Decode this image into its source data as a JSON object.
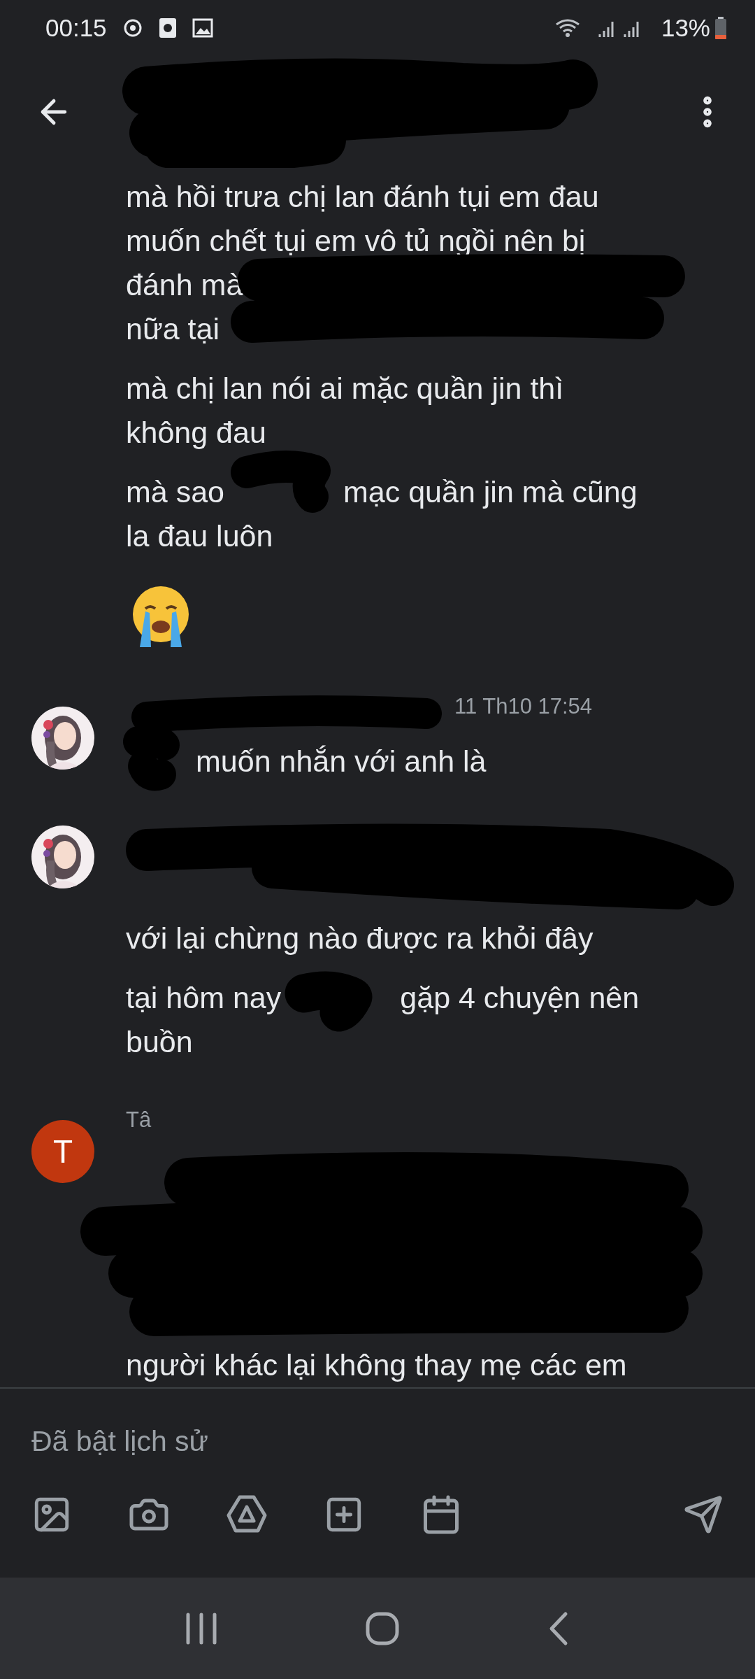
{
  "status_bar": {
    "time": "00:15",
    "battery": "13%"
  },
  "compose": {
    "placeholder": "Đã bật lịch sử"
  },
  "groups": [
    {
      "messages": [
        {
          "kind": "text",
          "lines": [
            [
              {
                "kind": "text",
                "text": "mà hồi trưa chị lan đánh tụi em đau"
              }
            ],
            [
              {
                "kind": "text",
                "text": "muốn chết tụi em vô tủ ngồi nên bị"
              }
            ],
            [
              {
                "kind": "text",
                "text": "đánh mà"
              }
            ],
            [
              {
                "kind": "text",
                "text": "nữa tại"
              }
            ]
          ]
        },
        {
          "kind": "text",
          "lines": [
            [
              {
                "kind": "text",
                "text": "mà chị lan nói ai mặc quần jin thì"
              }
            ],
            [
              {
                "kind": "text",
                "text": "không đau"
              }
            ]
          ]
        },
        {
          "kind": "text",
          "lines": [
            [
              {
                "kind": "text",
                "text": "mà sao"
              },
              {
                "kind": "hidden"
              },
              {
                "kind": "text",
                "text": "mạc quần jin mà cũng"
              }
            ],
            [
              {
                "kind": "text",
                "text": "la đau luôn"
              }
            ]
          ]
        },
        {
          "kind": "sticker"
        }
      ]
    },
    {
      "avatar": {
        "kind": "picture"
      },
      "time": "11 Th10 17:54",
      "messages": [
        {
          "kind": "text",
          "lines": [
            [
              {
                "kind": "hidden"
              },
              {
                "kind": "text",
                "text": "muốn nhắn với anh là"
              }
            ]
          ]
        }
      ]
    },
    {
      "avatar": {
        "kind": "picture"
      },
      "messages": [
        {
          "kind": "redacted_line"
        },
        {
          "kind": "text",
          "lines": [
            [
              {
                "kind": "text",
                "text": "với lại chừng nào được ra khỏi đây"
              }
            ]
          ]
        },
        {
          "kind": "text",
          "lines": [
            [
              {
                "kind": "text",
                "text": "tại hôm nay"
              },
              {
                "kind": "hidden"
              },
              {
                "kind": "text",
                "text": "gặp 4 chuyện nên"
              }
            ],
            [
              {
                "kind": "text",
                "text": "buồn"
              }
            ]
          ]
        }
      ]
    },
    {
      "avatar": {
        "kind": "letter",
        "letter": "T",
        "color": "#c1370f"
      },
      "sender": "Tâ",
      "messages": [
        {
          "kind": "redacted_block"
        },
        {
          "kind": "text",
          "lines": [
            [
              {
                "kind": "text",
                "text": "người khác lại không thay mẹ các em"
              }
            ]
          ]
        }
      ]
    }
  ]
}
